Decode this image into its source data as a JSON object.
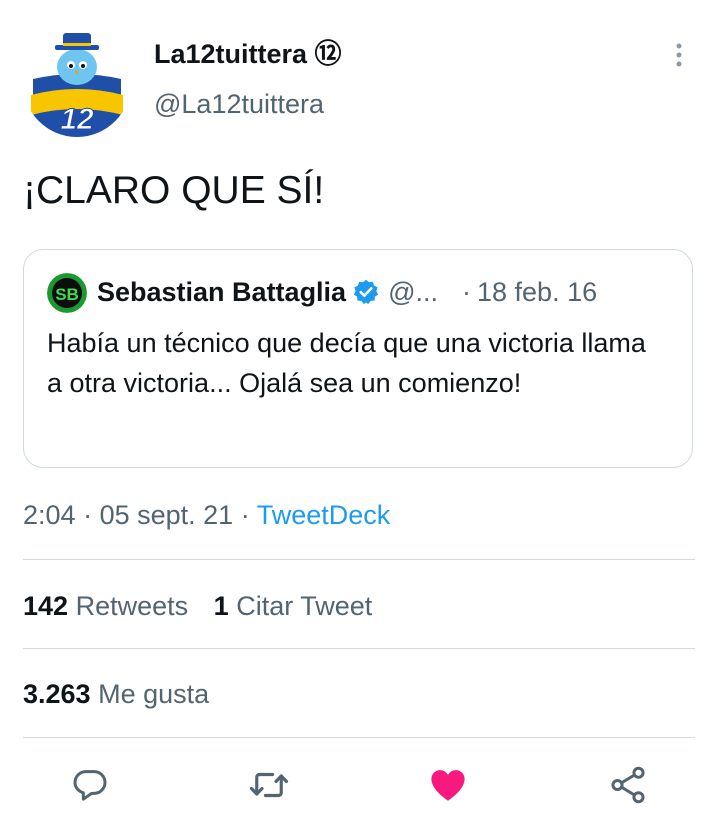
{
  "author": {
    "name": "La12tuittera ⑫",
    "handle": "@La12tuittera"
  },
  "tweet": {
    "text": "¡CLARO QUE SÍ!"
  },
  "quoted": {
    "name": "Sebastian Battaglia",
    "handle": "@...",
    "dot": "·",
    "date": "18 feb. 16",
    "text": "Había un técnico que decía que una victoria llama a otra victoria... Ojalá sea un comienzo!",
    "avatar_text": "SB"
  },
  "meta": {
    "time": "2:04",
    "sep1": "·",
    "date": "05 sept. 21",
    "sep2": "·",
    "source": "TweetDeck"
  },
  "stats": {
    "retweets_count": "142",
    "retweets_label": "Retweets",
    "quotes_count": "1",
    "quotes_label": "Citar Tweet",
    "likes_count": "3.263",
    "likes_label": "Me gusta"
  },
  "icons": {
    "more": "more-vertical-icon",
    "verified": "verified-badge-icon",
    "reply": "reply-icon",
    "retweet": "retweet-icon",
    "like": "heart-filled-icon",
    "share": "share-icon"
  },
  "colors": {
    "accent": "#1d9bf0",
    "like": "#f91880",
    "muted": "#536471",
    "text": "#0f1419",
    "border": "#cfd9de"
  }
}
